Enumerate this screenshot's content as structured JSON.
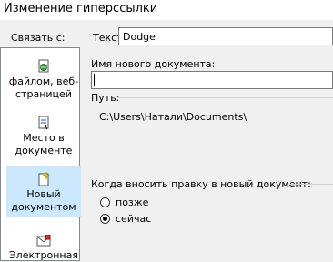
{
  "window": {
    "title": "Изменение гиперссылки"
  },
  "link_with": {
    "label": "Связать с:"
  },
  "text_field": {
    "label": "Текст:",
    "value": "Dodge"
  },
  "sidebar": {
    "items": [
      {
        "label_line1": "файлом, веб-",
        "label_line2": "страницей",
        "icon": "file-web-icon",
        "selected": false
      },
      {
        "label_line1": "Место в",
        "label_line2": "документе",
        "icon": "document-place-icon",
        "selected": false
      },
      {
        "label_line1": "Новый",
        "label_line2": "документом",
        "icon": "new-document-icon",
        "selected": true
      },
      {
        "label_line1": "Электронная",
        "label_line2": "",
        "icon": "email-icon",
        "selected": false
      }
    ]
  },
  "new_document": {
    "label": "Имя нового документа:",
    "value": ""
  },
  "path": {
    "label": "Путь:",
    "value": "C:\\Users\\Натали\\Documents\\"
  },
  "edit_when": {
    "label": "Когда вносить правку в новый документ:",
    "options": [
      {
        "label": "позже",
        "checked": false
      },
      {
        "label": "сейчас",
        "checked": true
      }
    ]
  },
  "colors": {
    "selection": "#cce8ff",
    "background": "#f0f0f0",
    "border": "#7a7a7a"
  }
}
